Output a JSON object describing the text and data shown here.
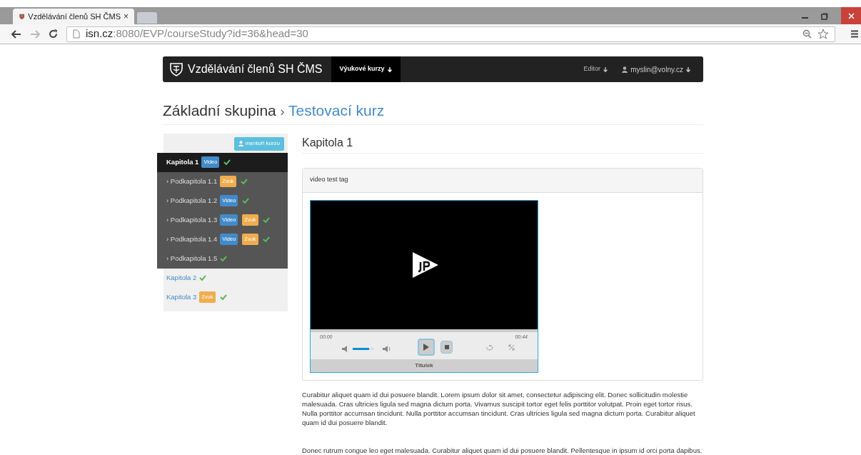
{
  "browser": {
    "tab_title": "Vzdělávání členů SH ČMS",
    "tab_close": "×",
    "url_host": "isn.cz",
    "url_rest": ":8080/EVP/courseStudy?id=36&head=30"
  },
  "navbar": {
    "brand": "Vzdělávání členů SH ČMS",
    "items": [
      {
        "label": "Výukové kurzy",
        "selected": true
      },
      {
        "label": "Editor",
        "selected": false
      }
    ],
    "user": "myslin@volny.cz"
  },
  "breadcrumb": {
    "group": "Základní skupina",
    "separator": "›",
    "course": "Testovací kurz"
  },
  "sidebar": {
    "mentors_button": "mentoři kurzu",
    "items": [
      {
        "label": "Kapitola 1",
        "selected": true,
        "done": true,
        "tags": [
          {
            "kind": "video",
            "label": "Video"
          }
        ],
        "children": [
          {
            "prefix": "›",
            "label": "Podkapitola 1.1",
            "done": true,
            "tags": [
              {
                "kind": "zvuk",
                "label": "Zvuk"
              }
            ]
          },
          {
            "prefix": "›",
            "label": "Podkapitola 1.2",
            "done": true,
            "tags": [
              {
                "kind": "video",
                "label": "Video"
              }
            ]
          },
          {
            "prefix": "›",
            "label": "Podkapitola 1.3",
            "done": true,
            "tags": [
              {
                "kind": "video",
                "label": "Video"
              },
              {
                "kind": "zvuk",
                "label": "Zvuk"
              }
            ]
          },
          {
            "prefix": "›",
            "label": "Podkapitola 1.4",
            "done": true,
            "tags": [
              {
                "kind": "video",
                "label": "Video"
              },
              {
                "kind": "zvuk",
                "label": "Zvuk"
              }
            ]
          },
          {
            "prefix": "›",
            "label": "Podkapitola 1.5",
            "done": true
          }
        ]
      },
      {
        "label": "Kapitola 2",
        "selected": false,
        "done": true
      },
      {
        "label": "Kapitola 3",
        "selected": false,
        "done": true,
        "tags": [
          {
            "kind": "zvuk",
            "label": "Zvuk"
          }
        ]
      }
    ]
  },
  "content": {
    "heading": "Kapitola 1",
    "panel_title": "video test tag",
    "player": {
      "current_time": "00:00",
      "duration": "00:44",
      "volume": {
        "level": 0.75
      },
      "caption": "Titulek"
    },
    "paragraphs": [
      "Curabitur aliquet quam id dui posuere blandit. Lorem ipsum dolor sit amet, consectetur adipiscing elit. Donec sollicitudin molestie malesuada. Cras ultricies ligula sed magna dictum porta. Vivamus suscipit tortor eget felis porttitor volutpat. Proin eget tortor risus. Nulla porttitor accumsan tincidunt. Nulla porttitor accumsan tincidunt. Cras ultricies ligula sed magna dictum porta. Curabitur aliquet quam id dui posuere blandit.",
      "Donec rutrum congue leo eget malesuada. Curabitur aliquet quam id dui posuere blandit. Pellentesque in ipsum id orci porta dapibus."
    ]
  }
}
